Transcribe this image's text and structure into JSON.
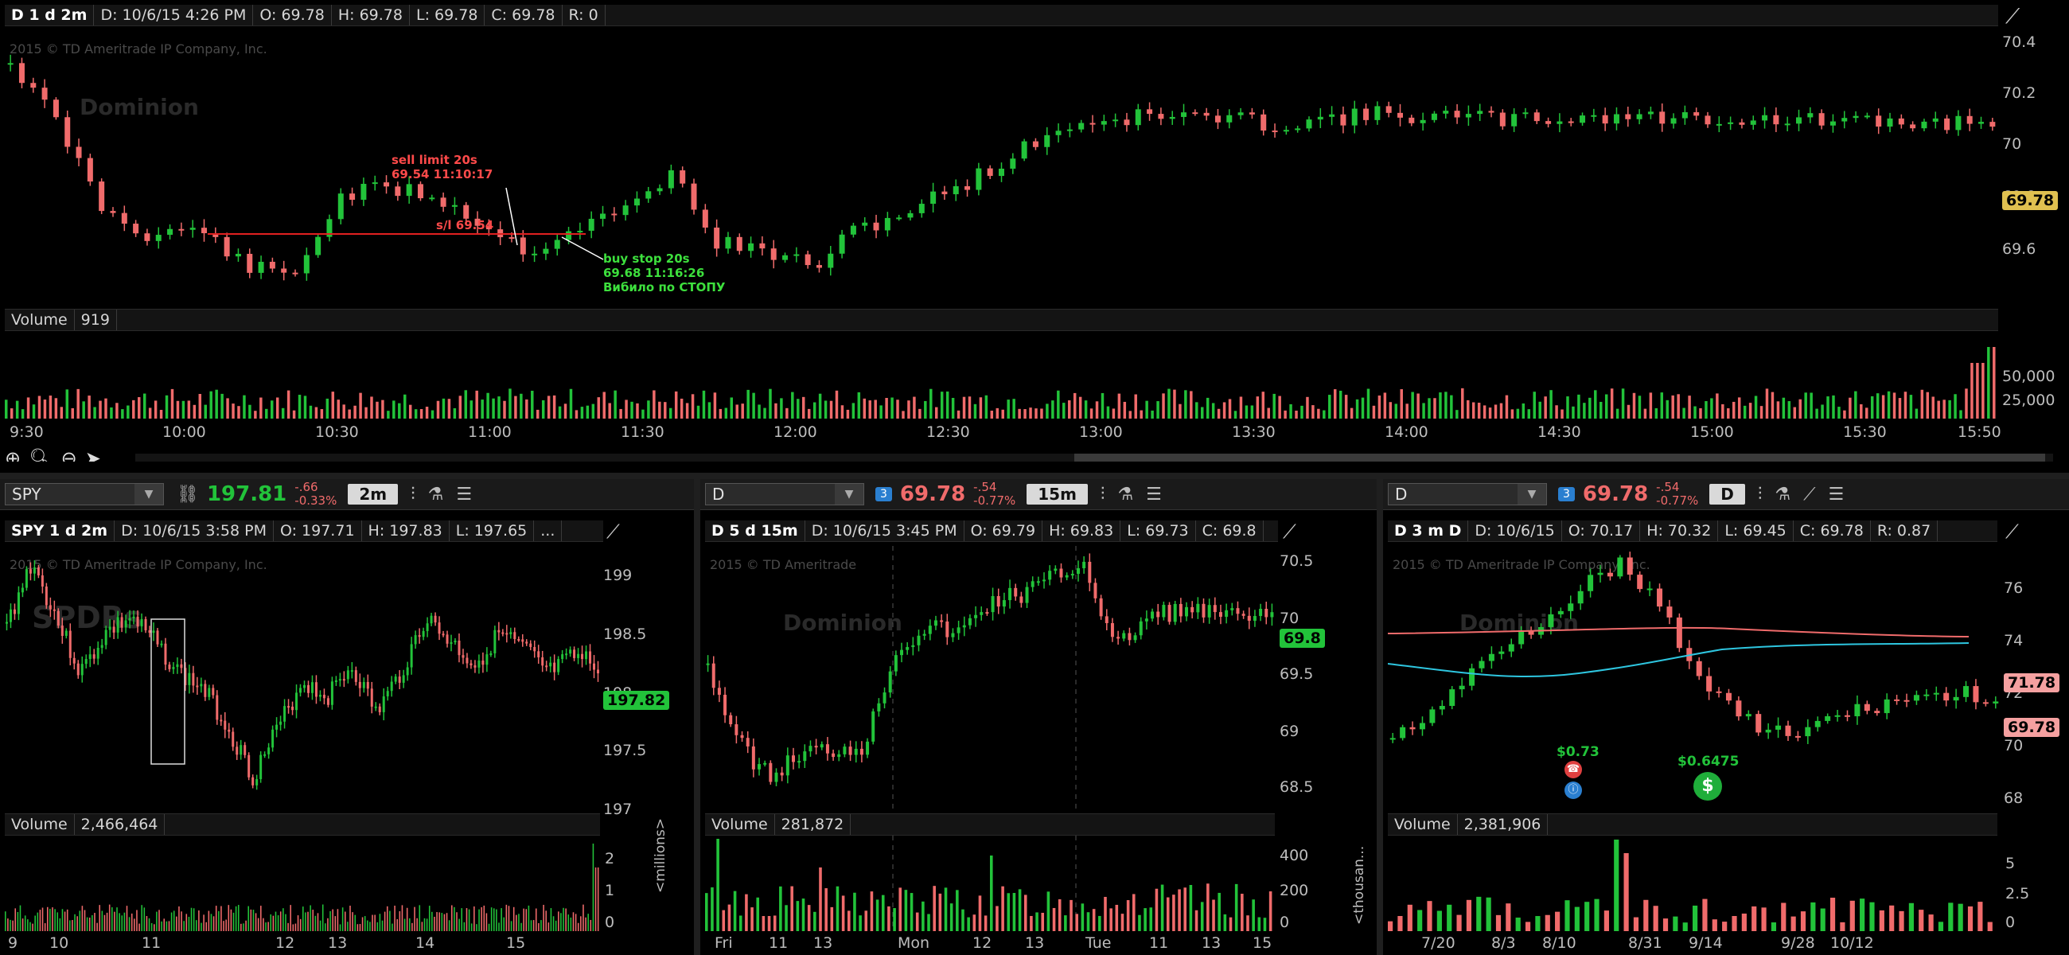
{
  "colors": {
    "up": "#22c33a",
    "down": "#f06b6b",
    "accent": "#2a7fd0",
    "bg": "#000000"
  },
  "top": {
    "header": {
      "title": "D 1 d 2m",
      "date": "D: 10/6/15 4:26 PM",
      "open": "O: 69.78",
      "high": "H: 69.78",
      "low": "L: 69.78",
      "close": "C: 69.78",
      "range": "R: 0"
    },
    "copyright": "2015 © TD Ameritrade IP Company, Inc.",
    "logo": "Dominion",
    "price_tag": "69.78",
    "yticks": [
      "70.4",
      "70.2",
      "70",
      "69.8",
      "69.6"
    ],
    "annotations": {
      "sell": [
        "sell limit 20s",
        "69.54 11:10:17"
      ],
      "sl": "s/l 69.54",
      "buy": [
        "buy stop 20s",
        "69.68 11:16:26",
        "Вибило по СТОПУ"
      ]
    },
    "volume": {
      "label": "Volume",
      "value": "919",
      "yticks": [
        "50,000",
        "25,000"
      ]
    },
    "xticks": [
      "9:30",
      "10:00",
      "10:30",
      "11:00",
      "11:30",
      "12:00",
      "12:30",
      "13:00",
      "13:30",
      "14:00",
      "14:30",
      "15:00",
      "15:30",
      "15:50"
    ]
  },
  "spy": {
    "toolbar": {
      "symbol": "SPY",
      "last": "197.81",
      "chg": "-.66",
      "chg_pct": "-0.33%",
      "agg": "2m"
    },
    "header": {
      "title": "SPY 1 d 2m",
      "date": "D: 10/6/15 3:58 PM",
      "open": "O: 197.71",
      "high": "H: 197.83",
      "low": "L: 197.65",
      "more": "..."
    },
    "copyright": "2015 © TD Ameritrade IP Company, Inc.",
    "logo": "SPDRs",
    "price_tag": "197.82",
    "yticks": [
      "199",
      "198.5",
      "198",
      "197.5",
      "197"
    ],
    "volume": {
      "label": "Volume",
      "value": "2,466,464",
      "yticks": [
        "2",
        "1",
        "0"
      ],
      "unit": "<millions>"
    },
    "xticks": [
      "9",
      "10",
      "11",
      "12",
      "13",
      "14",
      "15"
    ]
  },
  "d15": {
    "toolbar": {
      "symbol": "D",
      "badge": "3",
      "last": "69.78",
      "chg": "-.54",
      "chg_pct": "-0.77%",
      "agg": "15m"
    },
    "header": {
      "title": "D 5 d 15m",
      "date": "D: 10/6/15 3:45 PM",
      "open": "O: 69.79",
      "high": "H: 69.83",
      "low": "L: 69.73",
      "close": "C: 69.8"
    },
    "copyright": "2015 © TD Ameritrade",
    "logo": "Dominion",
    "price_tag": "69.8",
    "yticks": [
      "70.5",
      "70",
      "69.5",
      "69",
      "68.5"
    ],
    "volume": {
      "label": "Volume",
      "value": "281,872",
      "yticks": [
        "400",
        "200",
        "0"
      ],
      "unit": "<thousan..."
    },
    "xticks": [
      "Fri",
      "11",
      "13",
      "Mon",
      "12",
      "13",
      "Tue",
      "11",
      "13",
      "15"
    ]
  },
  "d3m": {
    "toolbar": {
      "symbol": "D",
      "badge": "3",
      "last": "69.78",
      "chg": "-.54",
      "chg_pct": "-0.77%",
      "agg": "D"
    },
    "header": {
      "title": "D 3 m D",
      "date": "D: 10/6/15",
      "open": "O: 70.17",
      "high": "H: 70.32",
      "low": "L: 69.45",
      "close": "C: 69.78",
      "range": "R: 0.87"
    },
    "copyright": "2015 © TD Ameritrade IP Company, Inc.",
    "logo": "Dominion",
    "price_tag": "69.78",
    "ma_tag": "71.78",
    "yticks": [
      "76",
      "74",
      "72",
      "70",
      "68"
    ],
    "div1": "$0.73",
    "div2": "$0.6475",
    "volume": {
      "label": "Volume",
      "value": "2,381,906",
      "yticks": [
        "5",
        "2.5",
        "0"
      ]
    },
    "xticks": [
      "7/20",
      "8/3",
      "8/10",
      "8/31",
      "9/14",
      "9/28",
      "10/12"
    ]
  }
}
